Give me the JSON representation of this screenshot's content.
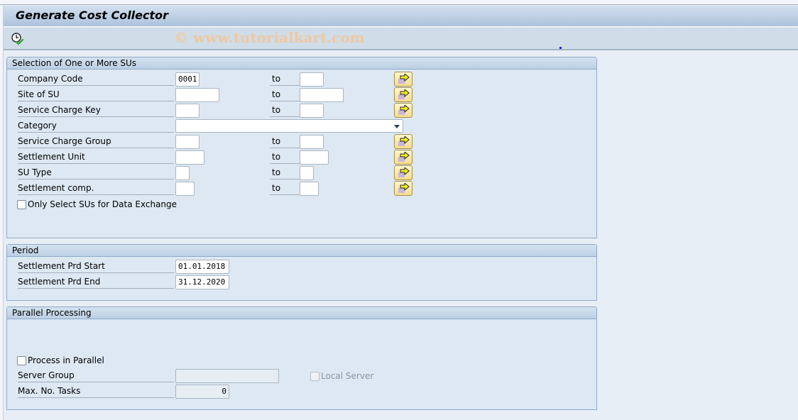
{
  "window": {
    "title": "Generate Cost Collector",
    "watermark": "© www.tutorialkart.com"
  },
  "toolbar": {
    "execute_icon": "clock-check-icon"
  },
  "selection": {
    "title": "Selection of One or More SUs",
    "to_label": "to",
    "rows": [
      {
        "label": "Company Code",
        "from": "0001",
        "to": ""
      },
      {
        "label": "Site of SU",
        "from": "",
        "to": ""
      },
      {
        "label": "Service Charge Key",
        "from": "",
        "to": ""
      },
      {
        "label": "Category",
        "value": ""
      },
      {
        "label": "Service Charge Group",
        "from": "",
        "to": ""
      },
      {
        "label": "Settlement Unit",
        "from": "",
        "to": ""
      },
      {
        "label": "SU Type",
        "from": "",
        "to": ""
      },
      {
        "label": "Settlement comp.",
        "from": "",
        "to": ""
      }
    ],
    "checkbox_label": "Only Select SUs for Data Exchange",
    "checkbox_checked": false,
    "multi_icon": "multiple-selection-arrow-icon"
  },
  "period": {
    "title": "Period",
    "start_label": "Settlement Prd Start",
    "start_value": "01.01.2018",
    "end_label": "Settlement Prd End",
    "end_value": "31.12.2020"
  },
  "parallel": {
    "title": "Parallel Processing",
    "process_label": "Process in Parallel",
    "process_checked": false,
    "server_group_label": "Server Group",
    "server_group_value": "",
    "local_server_label": "Local Server",
    "local_server_checked": false,
    "max_tasks_label": "Max. No. Tasks",
    "max_tasks_value": "0"
  }
}
